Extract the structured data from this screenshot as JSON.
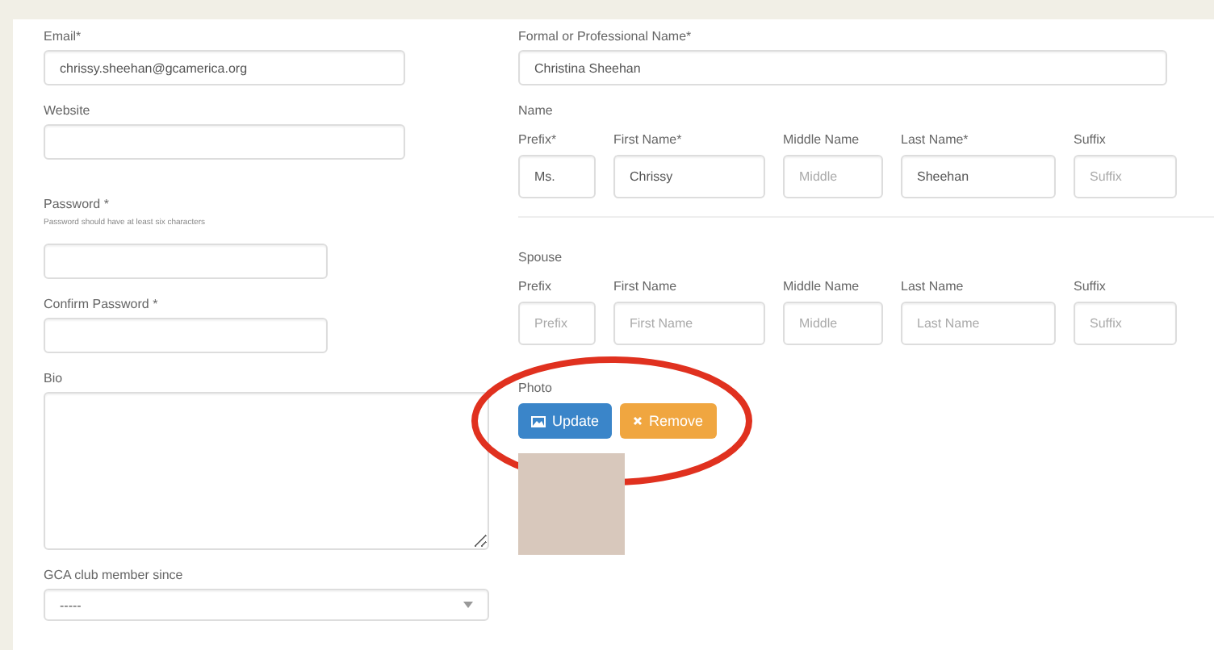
{
  "left_fields": [
    {
      "kind": "input",
      "label": "Email*",
      "value": "chrissy.sheehan@gcamerica.org"
    },
    {
      "kind": "input",
      "label": "Website"
    },
    {
      "kind": "password",
      "label": "Password *",
      "hint": "Password should have at least six characters"
    },
    {
      "kind": "password",
      "label": "Confirm Password *"
    },
    {
      "kind": "textarea",
      "label": "Bio"
    },
    {
      "kind": "select",
      "label": "GCA club member since",
      "value": "-----"
    }
  ],
  "formal_name": {
    "label": "Formal or Professional Name*",
    "value": "Christina Sheehan"
  },
  "name": {
    "title": "Name",
    "parts": [
      {
        "label": "Prefix*",
        "value": "Ms."
      },
      {
        "label": "First Name*",
        "value": "Chrissy"
      },
      {
        "label": "Middle Name",
        "placeholder": "Middle"
      },
      {
        "label": "Last Name*",
        "value": "Sheehan"
      },
      {
        "label": "Suffix",
        "placeholder": "Suffix"
      }
    ]
  },
  "spouse": {
    "title": "Spouse",
    "parts": [
      {
        "label": "Prefix",
        "placeholder": "Prefix"
      },
      {
        "label": "First Name",
        "placeholder": "First Name"
      },
      {
        "label": "Middle Name",
        "placeholder": "Middle"
      },
      {
        "label": "Last Name",
        "placeholder": "Last Name"
      },
      {
        "label": "Suffix",
        "placeholder": "Suffix"
      }
    ]
  },
  "photo": {
    "label": "Photo",
    "buttons": [
      {
        "kind": "primary",
        "label": "Update"
      },
      {
        "kind": "warning",
        "label": "Remove"
      }
    ]
  }
}
